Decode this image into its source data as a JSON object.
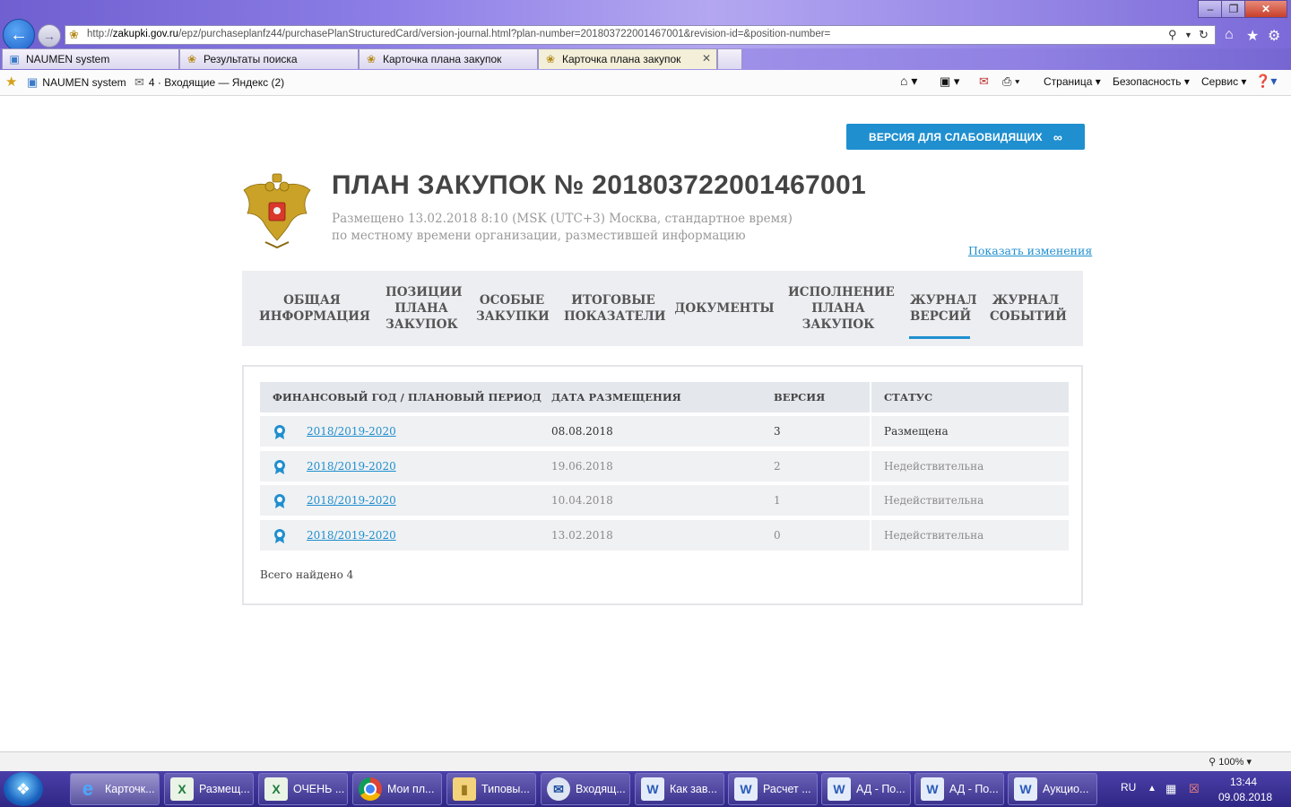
{
  "browser": {
    "url_prefix": "http://",
    "url_domain": "zakupki.gov.ru",
    "url_rest": "/epz/purchaseplanfz44/purchasePlanStructuredCard/version-journal.html?plan-number=201803722001467001&revision-id=&position-number=",
    "tabs": [
      {
        "label": "NAUMEN system"
      },
      {
        "label": "Результаты поиска"
      },
      {
        "label": "Карточка плана закупок"
      },
      {
        "label": "Карточка плана закупок"
      }
    ],
    "favorites": [
      {
        "label": "NAUMEN system"
      },
      {
        "label": "4 · Входящие — Яндекс (2)"
      }
    ],
    "commands": {
      "page": "Страница ▾",
      "security": "Безопасность ▾",
      "service": "Сервис ▾"
    },
    "zoom": "100%"
  },
  "page": {
    "low_vision_label": "ВЕРСИЯ ДЛЯ СЛАБОВИДЯЩИХ",
    "title": "ПЛАН ЗАКУПОК № 201803722001467001",
    "placed_line1": "Размещено 13.02.2018 8:10 (MSK (UTC+3) Москва, стандартное время)",
    "placed_line2": "по местному времени организации, разместившей информацию",
    "show_changes": "Показать изменения",
    "nav_tabs": [
      {
        "label": "ОБЩАЯ ИНФОРМАЦИЯ"
      },
      {
        "label": "ПОЗИЦИИ ПЛАНА ЗАКУПОК"
      },
      {
        "label": "ОСОБЫЕ ЗАКУПКИ"
      },
      {
        "label": "ИТОГОВЫЕ ПОКАЗАТЕЛИ"
      },
      {
        "label": "ДОКУМЕНТЫ"
      },
      {
        "label": "ИСПОЛНЕНИЕ ПЛАНА ЗАКУПОК"
      },
      {
        "label": "ЖУРНАЛ ВЕРСИЙ"
      },
      {
        "label": "ЖУРНАЛ СОБЫТИЙ"
      }
    ],
    "table": {
      "columns": [
        "ФИНАНСОВЫЙ ГОД / ПЛАНОВЫЙ ПЕРИОД",
        "ДАТА РАЗМЕЩЕНИЯ",
        "ВЕРСИЯ",
        "СТАТУС"
      ],
      "rows": [
        {
          "year": "2018/2019-2020",
          "date": "08.08.2018",
          "version": "3",
          "status": "Размещена"
        },
        {
          "year": "2018/2019-2020",
          "date": "19.06.2018",
          "version": "2",
          "status": "Недействительна"
        },
        {
          "year": "2018/2019-2020",
          "date": "10.04.2018",
          "version": "1",
          "status": "Недействительна"
        },
        {
          "year": "2018/2019-2020",
          "date": "13.02.2018",
          "version": "0",
          "status": "Недействительна"
        }
      ]
    },
    "total_found": "Всего найдено 4"
  },
  "taskbar": {
    "items": [
      {
        "label": "Карточк...",
        "icon": "ie-icon"
      },
      {
        "label": "Размещ...",
        "icon": "excel-icon"
      },
      {
        "label": "ОЧЕНЬ ...",
        "icon": "excel-icon"
      },
      {
        "label": "Мои пл...",
        "icon": "chrome-icon"
      },
      {
        "label": "Типовы...",
        "icon": "folder-icon"
      },
      {
        "label": "Входящ...",
        "icon": "mail-icon"
      },
      {
        "label": "Как зав...",
        "icon": "word-icon"
      },
      {
        "label": "Расчет ...",
        "icon": "word-icon"
      },
      {
        "label": "АД - По...",
        "icon": "word-icon"
      },
      {
        "label": "АД - По...",
        "icon": "word-icon"
      },
      {
        "label": "Аукцио...",
        "icon": "word-icon"
      }
    ],
    "lang": "RU",
    "time": "13:44",
    "date": "09.08.2018"
  },
  "colors": {
    "accent": "#1f8fcf",
    "title_gray": "#444444",
    "muted": "#9a9a9a"
  }
}
